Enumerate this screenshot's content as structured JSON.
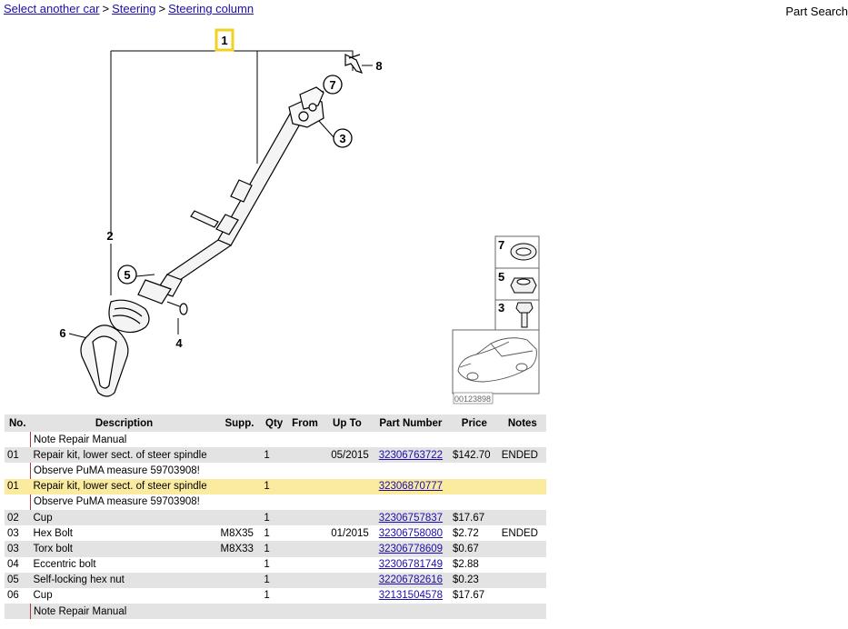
{
  "breadcrumb": {
    "items": [
      {
        "label": "Select another car"
      },
      {
        "label": "Steering"
      },
      {
        "label": "Steering column"
      }
    ],
    "separator": ">"
  },
  "header": {
    "search_label": "Part Search"
  },
  "diagram": {
    "callouts": [
      "1",
      "2",
      "3",
      "4",
      "5",
      "6",
      "7",
      "8"
    ],
    "thumb_labels": [
      "7",
      "5",
      "3"
    ],
    "image_id_label": "00123898",
    "highlight_color": "#f2d024"
  },
  "table": {
    "headers": [
      "No.",
      "Description",
      "Supp.",
      "Qty",
      "From",
      "Up To",
      "Part Number",
      "Price",
      "Notes"
    ],
    "rows": [
      {
        "no": "",
        "desc": "Note Repair Manual",
        "supp": "",
        "qty": "",
        "from": "",
        "upto": "",
        "part": "",
        "price": "",
        "notes": "",
        "note": true
      },
      {
        "no": "01",
        "desc": "Repair kit, lower sect. of steer spindle",
        "supp": "",
        "qty": "1",
        "from": "",
        "upto": "05/2015",
        "part": "32306763722",
        "price": "$142.70",
        "notes": "ENDED"
      },
      {
        "no": "",
        "desc": "Observe PuMA measure 59703908!",
        "supp": "",
        "qty": "",
        "from": "",
        "upto": "",
        "part": "",
        "price": "",
        "notes": "",
        "note": true
      },
      {
        "no": "01",
        "desc": "Repair kit, lower sect. of steer spindle",
        "supp": "",
        "qty": "1",
        "from": "",
        "upto": "",
        "part": "32306870777",
        "price": "",
        "notes": "",
        "highlight": true
      },
      {
        "no": "",
        "desc": "Observe PuMA measure 59703908!",
        "supp": "",
        "qty": "",
        "from": "",
        "upto": "",
        "part": "",
        "price": "",
        "notes": "",
        "note": true
      },
      {
        "no": "02",
        "desc": "Cup",
        "supp": "",
        "qty": "1",
        "from": "",
        "upto": "",
        "part": "32306757837",
        "price": "$17.67",
        "notes": ""
      },
      {
        "no": "03",
        "desc": "Hex Bolt",
        "supp": "M8X35",
        "qty": "1",
        "from": "",
        "upto": "01/2015",
        "part": "32306758080",
        "price": "$2.72",
        "notes": "ENDED"
      },
      {
        "no": "03",
        "desc": "Torx bolt",
        "supp": "M8X33",
        "qty": "1",
        "from": "",
        "upto": "",
        "part": "32306778609",
        "price": "$0.67",
        "notes": ""
      },
      {
        "no": "04",
        "desc": "Eccentric bolt",
        "supp": "",
        "qty": "1",
        "from": "",
        "upto": "",
        "part": "32306781749",
        "price": "$2.88",
        "notes": ""
      },
      {
        "no": "05",
        "desc": "Self-locking hex nut",
        "supp": "",
        "qty": "1",
        "from": "",
        "upto": "",
        "part": "32206782616",
        "price": "$0.23",
        "notes": ""
      },
      {
        "no": "06",
        "desc": "Cup",
        "supp": "",
        "qty": "1",
        "from": "",
        "upto": "",
        "part": "32131504578",
        "price": "$17.67",
        "notes": ""
      },
      {
        "no": "",
        "desc": "Note Repair Manual",
        "supp": "",
        "qty": "",
        "from": "",
        "upto": "",
        "part": "",
        "price": "",
        "notes": "",
        "note": true
      }
    ]
  }
}
